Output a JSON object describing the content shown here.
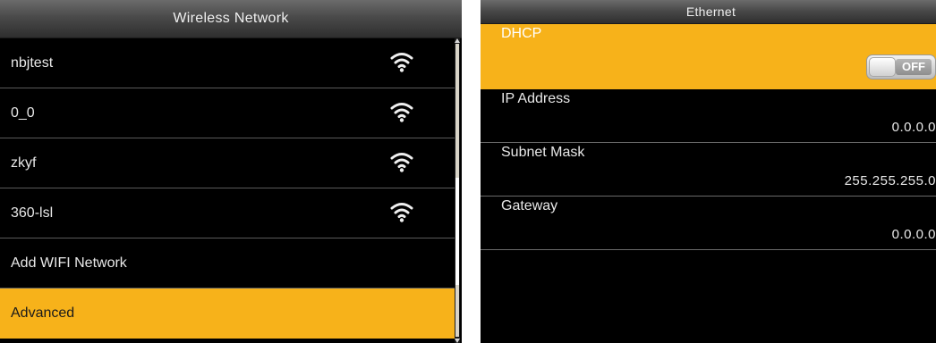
{
  "wireless": {
    "title": "Wireless Network",
    "networks": [
      {
        "ssid": "nbjtest",
        "signal_icon": "wifi-signal-icon"
      },
      {
        "ssid": "0_0",
        "signal_icon": "wifi-signal-icon"
      },
      {
        "ssid": "zkyf",
        "signal_icon": "wifi-signal-icon"
      },
      {
        "ssid": "360-lsl",
        "signal_icon": "wifi-signal-icon"
      }
    ],
    "add_label": "Add WIFI Network",
    "advanced_label": "Advanced",
    "selected_item": "Advanced"
  },
  "ethernet": {
    "title": "Ethernet",
    "dhcp": {
      "label": "DHCP",
      "state": "OFF"
    },
    "ip": {
      "label": "IP Address",
      "value": "0.0.0.0"
    },
    "subnet": {
      "label": "Subnet Mask",
      "value": "255.255.255.0"
    },
    "gateway": {
      "label": "Gateway",
      "value": "0.0.0.0"
    }
  },
  "colors": {
    "highlight": "#f7b21a",
    "background": "#000000",
    "text": "#e8e8e8"
  }
}
